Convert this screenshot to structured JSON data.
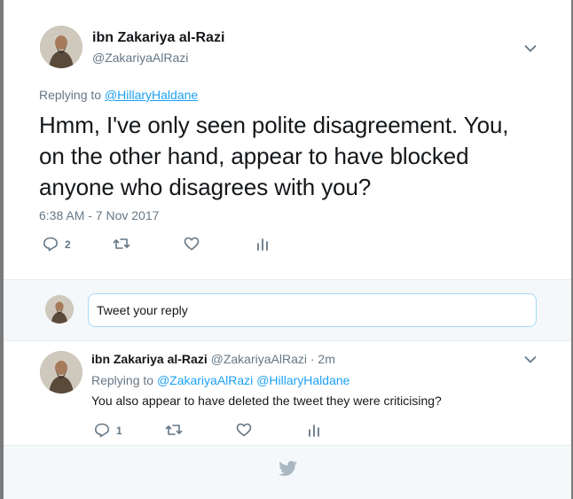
{
  "tweet": {
    "author_name": "ibn Zakariya al-Razi",
    "author_handle": "@ZakariyaAlRazi",
    "replying_prefix": "Replying to",
    "replying_to": "@HillaryHaldane",
    "text": "Hmm, I've only seen polite disagreement. You, on the other hand, appear to have blocked anyone who disagrees with you?",
    "timestamp": "6:38 AM - 7 Nov 2017",
    "actions": {
      "reply_icon": "reply-icon",
      "reply_count": "2",
      "retweet_icon": "retweet-icon",
      "like_icon": "heart-icon",
      "analytics_icon": "analytics-icon"
    },
    "menu_icon": "chevron-down-icon"
  },
  "reply_box": {
    "placeholder": "Tweet your reply"
  },
  "reply": {
    "author_name": "ibn Zakariya al-Razi",
    "author_handle": "@ZakariyaAlRazi",
    "separator": "·",
    "time": "2m",
    "replying_prefix": "Replying to",
    "replying_to_1": "@ZakariyaAlRazi",
    "replying_to_2": "@HillaryHaldane",
    "text": "You also appear to have deleted the tweet they were criticising?",
    "actions": {
      "reply_count": "1"
    }
  },
  "footer": {
    "icon": "twitter-bird-icon"
  },
  "colors": {
    "link": "#1da1f2",
    "muted": "#657786",
    "text": "#14171a",
    "background_light": "#f5f8fa"
  }
}
